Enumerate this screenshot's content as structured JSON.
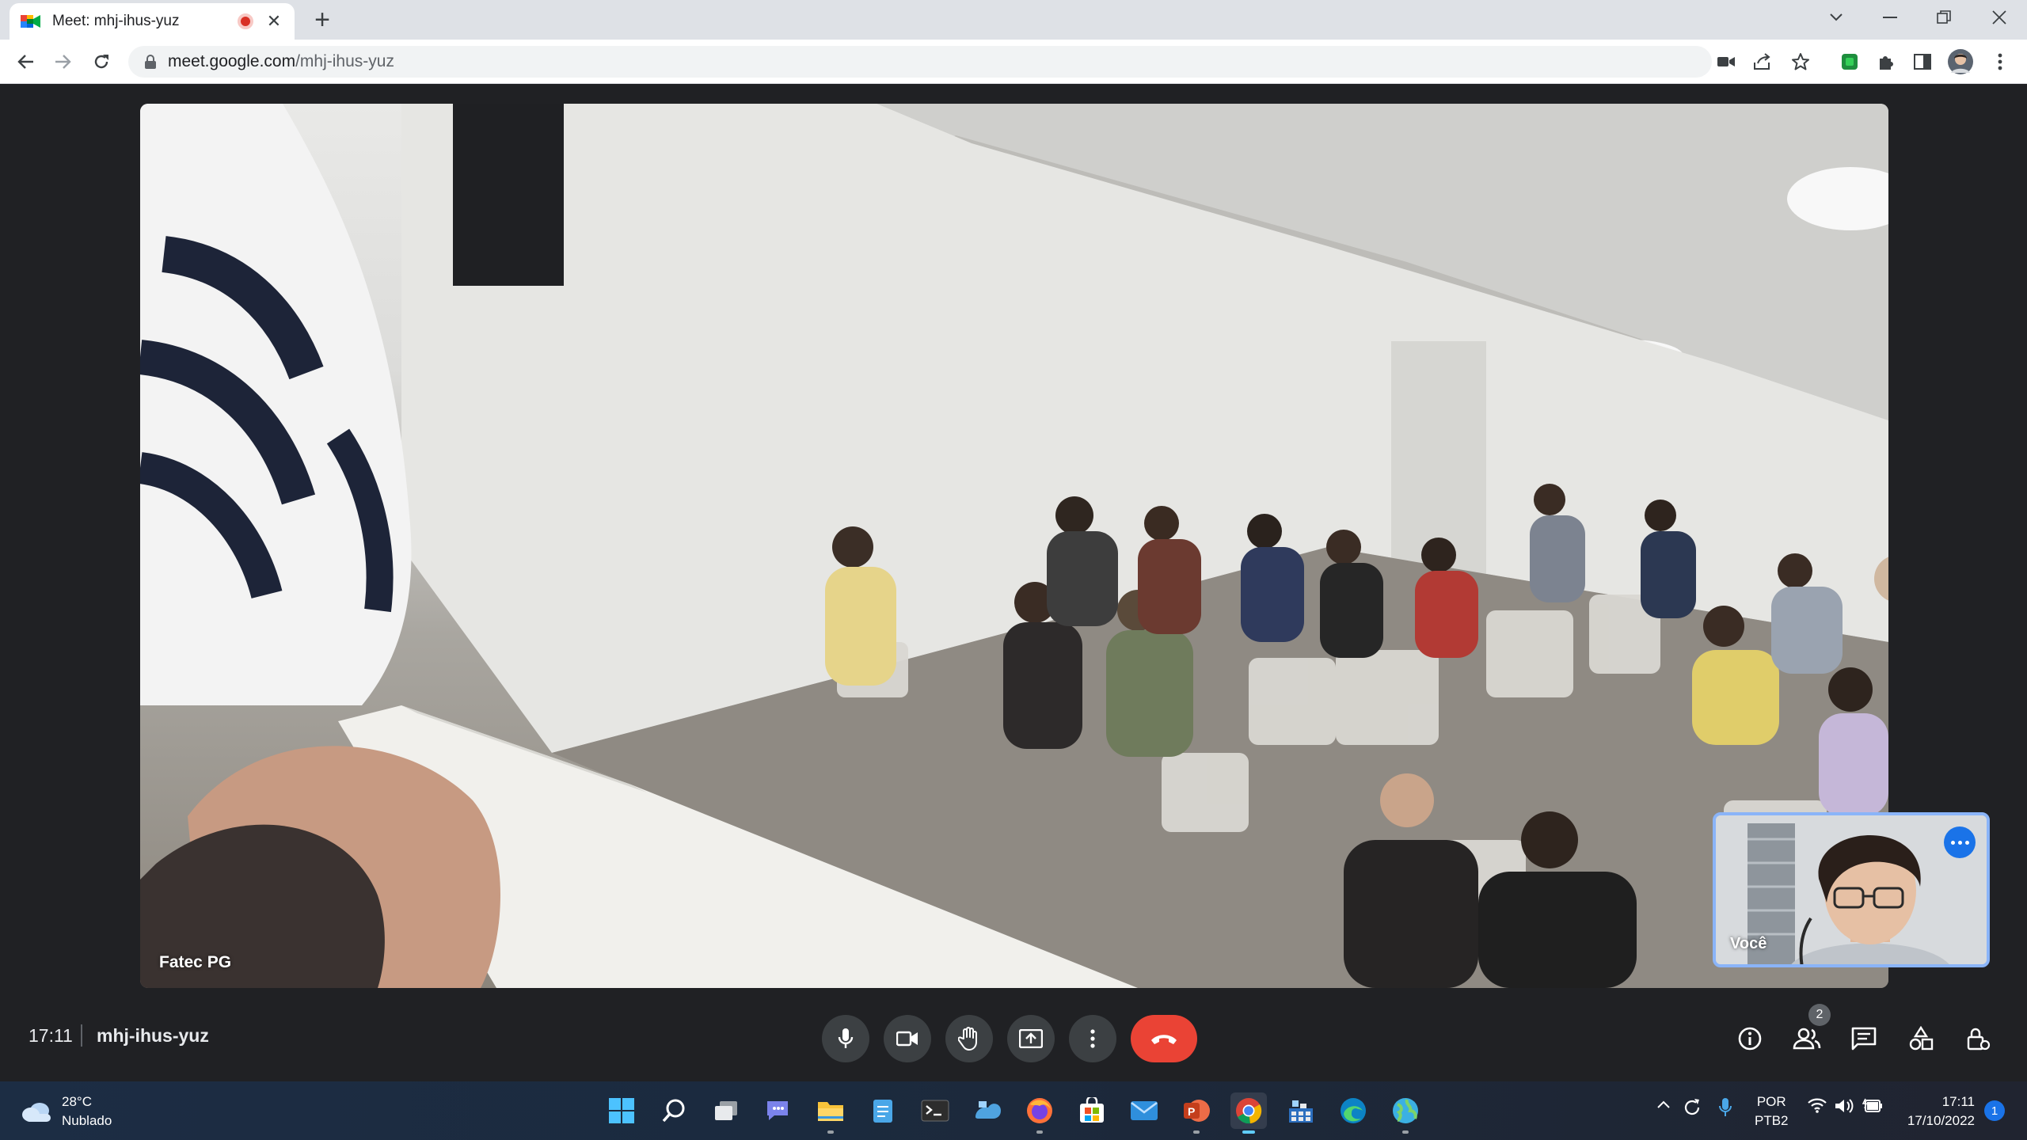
{
  "browser": {
    "tab_title": "Meet: mhj-ihus-yuz",
    "url_host": "meet.google.com",
    "url_path": "/mhj-ihus-yuz"
  },
  "meeting": {
    "main_tile_name": "Fatec PG",
    "self_view_name": "Você",
    "clock": "17:11",
    "meeting_code": "mhj-ihus-yuz",
    "participants_count": "2",
    "colors": {
      "end_call": "#ea4335",
      "control_bg": "#3c4043",
      "self_view_border": "#8ab4f8",
      "accent": "#1a73e8"
    }
  },
  "taskbar": {
    "weather_temp": "28°C",
    "weather_desc": "Nublado",
    "lang_line1": "POR",
    "lang_line2": "PTB2",
    "time": "17:11",
    "date": "17/10/2022",
    "notification_count": "1"
  }
}
